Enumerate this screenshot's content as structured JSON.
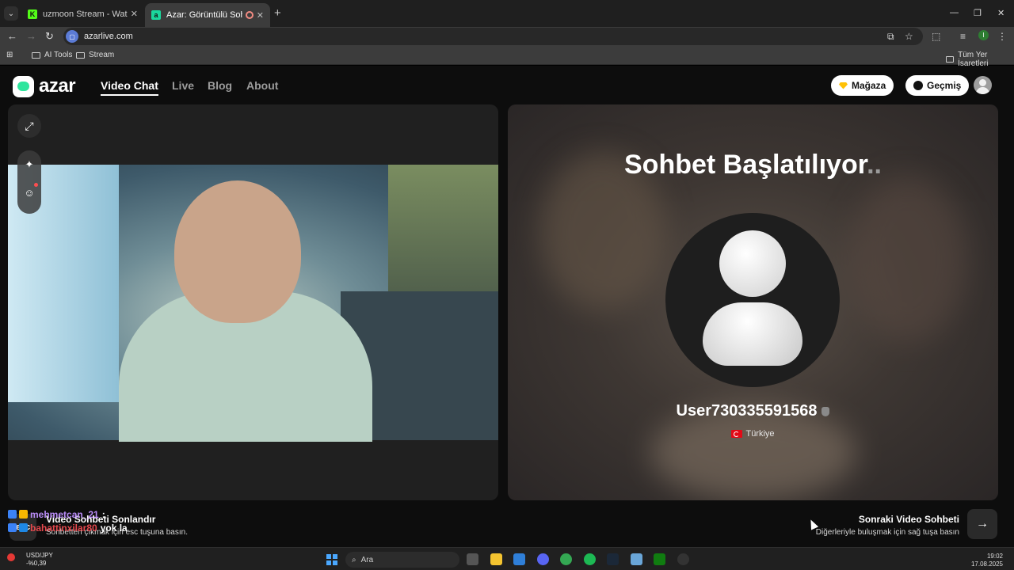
{
  "browser": {
    "tab_menu_icon": "chevron-down-icon",
    "tabs": [
      {
        "title": "uzmoon Stream - Watch Live o",
        "favicon": "K"
      },
      {
        "title": "Azar: Görüntülü Sohbet, Arka",
        "favicon": "a"
      }
    ],
    "url": "azarlive.com",
    "bookmarks": [
      {
        "label": "AI Tools"
      },
      {
        "label": "Stream"
      }
    ],
    "bookmarks_right": "Tüm Yer İşaretleri",
    "profile_initial": "I"
  },
  "site": {
    "logo": "azar",
    "nav": [
      {
        "label": "Video Chat"
      },
      {
        "label": "Live"
      },
      {
        "label": "Blog"
      },
      {
        "label": "About"
      }
    ],
    "store_label": "Mağaza",
    "history_label": "Geçmiş",
    "match": {
      "status": "Sohbet Başlatılıyor",
      "status_dots": "..",
      "username": "User730335591568",
      "country": "Türkiye"
    },
    "end_chat": {
      "key": "esc",
      "title": "Video Sohbeti Sonlandır",
      "subtitle": "Sohbetten çıkmak için esc tuşuna basın."
    },
    "next_chat": {
      "key_icon": "arrow-right-icon",
      "title": "Sonraki Video Sohbeti",
      "subtitle": "Diğerleriyle buluşmak için sağ tuşa basın"
    }
  },
  "stream_chat": [
    {
      "user": "mehmetcan_21",
      "message": ":"
    },
    {
      "user": "bahattinxilar80",
      "message": "yok la"
    }
  ],
  "taskbar": {
    "ticker_label": "USD/JPY",
    "ticker_value": "-%0,39",
    "search_placeholder": "Ara",
    "time": "19:02",
    "date": "17.08.2025"
  }
}
